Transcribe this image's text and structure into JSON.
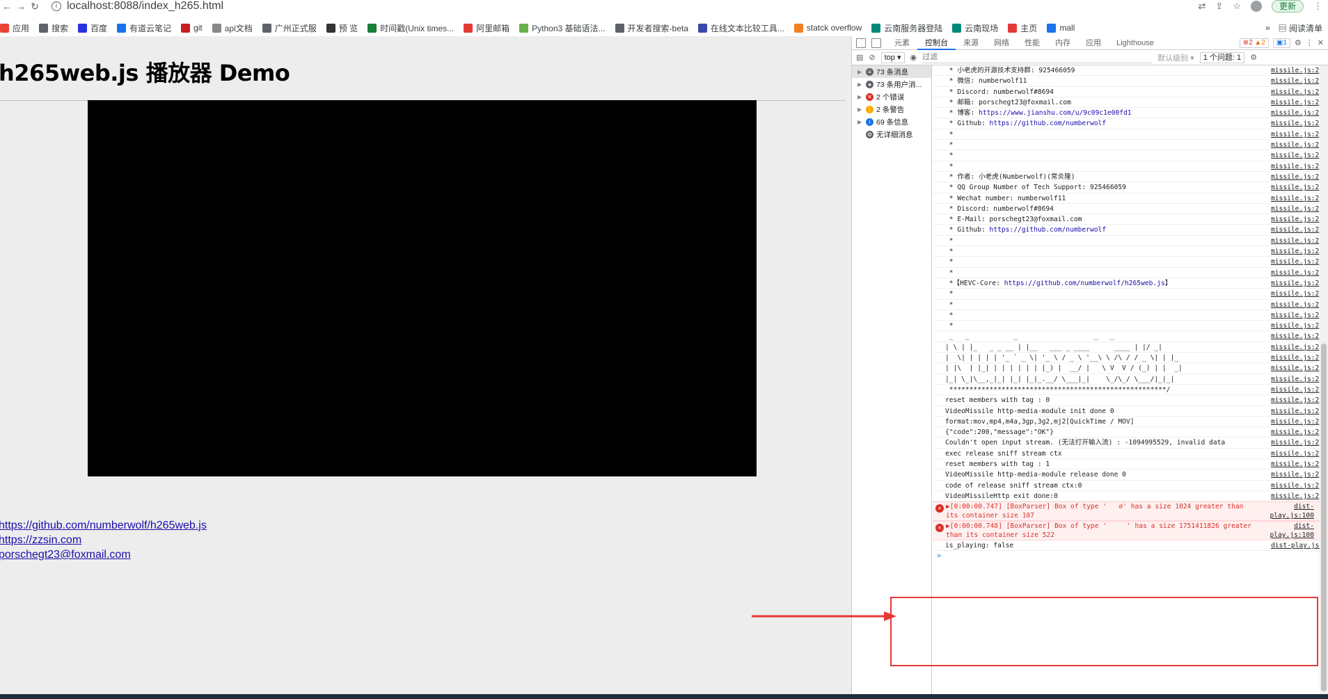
{
  "browser": {
    "url": "localhost:8088/index_h265.html",
    "update_label": "更新"
  },
  "bookmarks": [
    {
      "label": "应用",
      "icon": "apps-grid-icon"
    },
    {
      "label": "搜索",
      "icon": "globe-icon"
    },
    {
      "label": "百度",
      "icon": "baidu-paw-icon"
    },
    {
      "label": "有道云笔记",
      "icon": "youdao-note-icon"
    },
    {
      "label": "git",
      "icon": "gitee-icon"
    },
    {
      "label": "api文档",
      "icon": "yapi-icon"
    },
    {
      "label": "广州正式服",
      "icon": "globe-icon"
    },
    {
      "label": "预 览",
      "icon": "preview-icon"
    },
    {
      "label": "时间戳(Unix times...",
      "icon": "table-icon"
    },
    {
      "label": "阿里邮箱",
      "icon": "mail-m-icon"
    },
    {
      "label": "Python3 基础语法...",
      "icon": "runoob-icon"
    },
    {
      "label": "开发者搜索-beta",
      "icon": "globe-icon"
    },
    {
      "label": "在线文本比较工具...",
      "icon": "compare-icon"
    },
    {
      "label": "statck overflow",
      "icon": "stackoverflow-icon"
    },
    {
      "label": "云南服务器登陆",
      "icon": "server-icon"
    },
    {
      "label": "云南现场",
      "icon": "server-icon"
    },
    {
      "label": "主页",
      "icon": "home-icon"
    },
    {
      "label": "mall",
      "icon": "mall-icon"
    }
  ],
  "bookmarks_more": {
    "chevron": "»",
    "reading_list": "阅读清单"
  },
  "page": {
    "title": "h265web.js 播放器 Demo",
    "links": [
      "https://github.com/numberwolf/h265web.js",
      "https://zzsin.com",
      "porschegt23@foxmail.com"
    ]
  },
  "devtools": {
    "tabs": [
      "元素",
      "控制台",
      "来源",
      "网络",
      "性能",
      "内存",
      "应用",
      "Lighthouse"
    ],
    "active_tab": "控制台",
    "badges": {
      "errors": "2",
      "warnings": "2",
      "info": "1"
    },
    "context": "top",
    "filter_placeholder": "过滤",
    "levels": "默认级别",
    "issues": "1 个问题:  1",
    "sidebar": [
      {
        "label": "73 条消息",
        "icon": "list-icon"
      },
      {
        "label": "73 条用户消...",
        "icon": "user-icon"
      },
      {
        "label": "2 个错误",
        "icon": "error-icon"
      },
      {
        "label": "2 条警告",
        "icon": "warning-icon"
      },
      {
        "label": "69 条信息",
        "icon": "info-icon"
      },
      {
        "label": "无详细消息",
        "icon": "gear-icon"
      }
    ],
    "console_lines": [
      {
        "text": " * 小老虎的开源技术支持群: 925466059",
        "src": "missile.js:2"
      },
      {
        "text": " * 微信: numberwolf11",
        "src": "missile.js:2"
      },
      {
        "text": " * Discord: numberwolf#8694",
        "src": "missile.js:2"
      },
      {
        "text": " * 邮箱: porschegt23@foxmail.com",
        "src": "missile.js:2"
      },
      {
        "text": " * 博客: ",
        "link": "https://www.jianshu.com/u/9c09c1e00fd1",
        "src": "missile.js:2"
      },
      {
        "text": " * Github: ",
        "link": "https://github.com/numberwolf",
        "src": "missile.js:2"
      },
      {
        "text": " *",
        "src": "missile.js:2"
      },
      {
        "text": " *",
        "src": "missile.js:2"
      },
      {
        "text": " *",
        "src": "missile.js:2"
      },
      {
        "text": " *",
        "src": "missile.js:2"
      },
      {
        "text": " * 作者: 小老虎(Numberwolf)(常炎隆)",
        "src": "missile.js:2"
      },
      {
        "text": " * QQ Group Number of Tech Support: 925466059",
        "src": "missile.js:2"
      },
      {
        "text": " * Wechat number: numberwolf11",
        "src": "missile.js:2"
      },
      {
        "text": " * Discord: numberwolf#8694",
        "src": "missile.js:2"
      },
      {
        "text": " * E-Mail: porschegt23@foxmail.com",
        "src": "missile.js:2"
      },
      {
        "text": " * Github: ",
        "link": "https://github.com/numberwolf",
        "src": "missile.js:2"
      },
      {
        "text": " *",
        "src": "missile.js:2"
      },
      {
        "text": " *",
        "src": "missile.js:2"
      },
      {
        "text": " *",
        "src": "missile.js:2"
      },
      {
        "text": " *",
        "src": "missile.js:2"
      },
      {
        "text": " *【HEVC-Core: ",
        "link": "https://github.com/numberwolf/h265web.js",
        "suffix": "】",
        "src": "missile.js:2"
      },
      {
        "text": " *",
        "src": "missile.js:2"
      },
      {
        "text": " *",
        "src": "missile.js:2"
      },
      {
        "text": " *",
        "src": "missile.js:2"
      },
      {
        "text": " *",
        "src": "missile.js:2"
      },
      {
        "text": " _   _           _                   _   _",
        "src": "missile.js:2"
      },
      {
        "text": "| \\ | |_   _ _ __ | |__   ___ _ ____      ____ | |/ _|",
        "src": "missile.js:2"
      },
      {
        "text": "|  \\| | | | | '_ ` _ \\| '_ \\ / _ \\ '__\\ \\ /\\ / / _ \\| | |_",
        "src": "missile.js:2"
      },
      {
        "text": "| |\\  | |_| | | | | | | |_) |  __/ |   \\ V  V / (_) | |  _|",
        "src": "missile.js:2"
      },
      {
        "text": "|_| \\_|\\__,_|_| |_| |_|_.__/ \\___|_|    \\_/\\_/ \\___/|_|_|",
        "src": "missile.js:2"
      },
      {
        "text": " ******************************************************/",
        "src": "missile.js:2"
      },
      {
        "text": "reset members with tag : 0",
        "src": "missile.js:2"
      },
      {
        "text": "VideoMissile http-media-module init done 0",
        "src": "missile.js:2"
      },
      {
        "text": "format:mov,mp4,m4a,3gp,3g2,mj2[QuickTime / MOV]",
        "src": "missile.js:2"
      },
      {
        "text": "{\"code\":200,\"message\":\"OK\"}",
        "src": "missile.js:2"
      },
      {
        "text": "Couldn't open input stream. (无法打开输入流) : -1094995529, invalid data",
        "src": "missile.js:2"
      },
      {
        "text": "exec release sniff stream ctx",
        "src": "missile.js:2"
      },
      {
        "text": "reset members with tag : 1",
        "src": "missile.js:2"
      },
      {
        "text": "VideoMissile http-media-module release done 0",
        "src": "missile.js:2"
      },
      {
        "text": "code of release sniff stream ctx:0",
        "src": "missile.js:2"
      },
      {
        "text": "VideoMissileHttp exit done:0",
        "src": "missile.js:2"
      }
    ],
    "errors": [
      {
        "text": "▶[0:00:00.747] [BoxParser] Box of type '   ∅' has a size 1024 greater than its container size 107",
        "src": "dist-play.js:100"
      },
      {
        "text": "▶[0:00:00.748] [BoxParser] Box of type '     ' has a size 1751411826 greater than its container size 522",
        "src": "dist-play.js:100"
      }
    ],
    "last_line": {
      "text": "is_playing: false",
      "src": "dist-play.js:283"
    },
    "prompt": ">"
  }
}
